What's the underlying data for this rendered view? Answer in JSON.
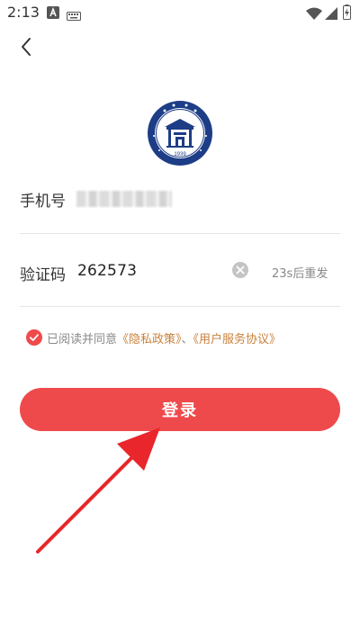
{
  "status_bar": {
    "time": "2:13",
    "icons": [
      "a-letter-notification-icon",
      "keyboard-icon",
      "wifi-icon",
      "signal-icon",
      "battery-charging-icon"
    ]
  },
  "nav": {
    "back_icon": "chevron-left-icon"
  },
  "form": {
    "phone_label": "手机号",
    "code_label": "验证码",
    "code_value": "262573",
    "resend_text": "23s后重发"
  },
  "agreement": {
    "prefix": "已阅读并同意",
    "privacy": "《隐私政策》",
    "separator": "、",
    "terms": "《用户服务协议》",
    "checked": true
  },
  "login": {
    "label": "登录"
  },
  "colors": {
    "accent": "#ef4a4b",
    "link": "#c9813b",
    "logo_blue": "#1d3d86"
  }
}
